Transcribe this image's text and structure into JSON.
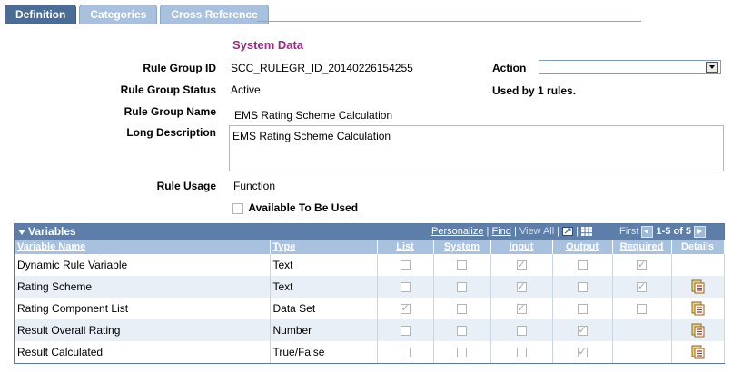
{
  "tabs": [
    {
      "label": "Definition"
    },
    {
      "label": "Categories"
    },
    {
      "label": "Cross Reference"
    }
  ],
  "section_title": "System Data",
  "fields": {
    "rule_group_id": {
      "label": "Rule Group ID",
      "value": "SCC_RULEGR_ID_20140226154255"
    },
    "rule_group_status": {
      "label": "Rule Group Status",
      "value": "Active"
    },
    "rule_group_name": {
      "label": "Rule Group Name",
      "value": "EMS Rating Scheme Calculation"
    },
    "long_description": {
      "label": "Long Description",
      "value": "EMS Rating Scheme Calculation"
    },
    "rule_usage": {
      "label": "Rule Usage",
      "value": "Function"
    },
    "available": {
      "label": "Available To Be Used",
      "checked": false
    }
  },
  "action": {
    "label": "Action",
    "value": ""
  },
  "used_by": "Used by 1 rules.",
  "grid": {
    "title": "Variables",
    "nav": {
      "personalize": "Personalize",
      "sep1": "|",
      "find": "Find",
      "sep2": "|",
      "view_all": "View All",
      "sep3": "|",
      "first": "First",
      "range": "1-5 of 5",
      "last": "Last"
    },
    "columns": [
      "Variable Name",
      "Type",
      "List",
      "System",
      "Input",
      "Output",
      "Required",
      "Details"
    ],
    "rows": [
      {
        "name": "Dynamic Rule Variable",
        "type": "Text",
        "list": false,
        "system": false,
        "input": true,
        "output": false,
        "required": true,
        "details": false
      },
      {
        "name": "Rating Scheme",
        "type": "Text",
        "list": false,
        "system": false,
        "input": true,
        "output": false,
        "required": true,
        "details": true
      },
      {
        "name": "Rating Component List",
        "type": "Data Set",
        "list": true,
        "system": false,
        "input": true,
        "output": false,
        "required": false,
        "details": true
      },
      {
        "name": "Result Overall Rating",
        "type": "Number",
        "list": false,
        "system": false,
        "input": false,
        "output": true,
        "required": null,
        "details": true
      },
      {
        "name": "Result Calculated",
        "type": "True/False",
        "list": false,
        "system": false,
        "input": false,
        "output": true,
        "required": null,
        "details": true
      }
    ]
  },
  "colors": {
    "tab_active": "#4a6d97",
    "tab_inactive": "#a7c1de",
    "section_title": "#9d2a88",
    "grid_header": "#5c7ea9",
    "grid_col_header": "#a8c1de",
    "row_alt": "#e9eff6"
  },
  "icons": {
    "collapse": "triangle-down-icon",
    "download": "download-icon",
    "grid": "grid-icon",
    "details": "details-page-icon"
  }
}
